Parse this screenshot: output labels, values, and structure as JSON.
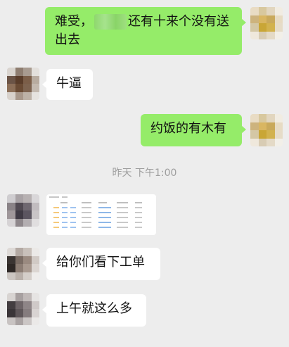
{
  "messages": [
    {
      "side": "right",
      "text_before": "难受，",
      "text_after": "还有十来个没有送出去"
    },
    {
      "side": "left",
      "text": "牛逼"
    },
    {
      "side": "right",
      "text": "约饭的有木有"
    },
    {
      "side": "left",
      "type": "image"
    },
    {
      "side": "left",
      "text": "给你们看下工单"
    },
    {
      "side": "left",
      "text": "上午就这么多"
    }
  ],
  "timestamp": "昨天 下午1:00",
  "colors": {
    "background": "#ededed",
    "bubble_self": "#95ec69",
    "bubble_other": "#ffffff",
    "timestamp_text": "#9e9e9e"
  }
}
